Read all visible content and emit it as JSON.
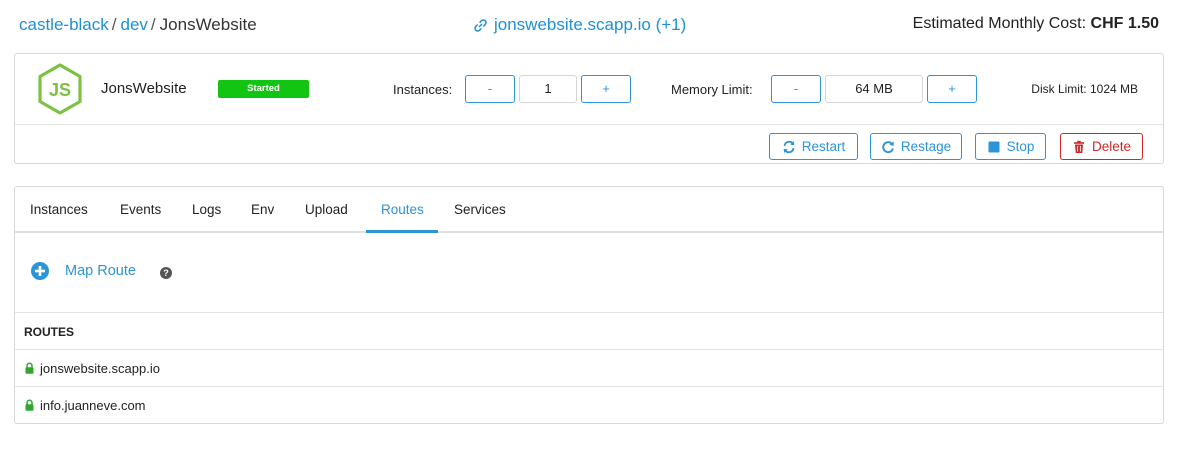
{
  "breadcrumb": {
    "items": [
      "castle-black",
      "dev"
    ],
    "separator": "/",
    "current": "JonsWebsite"
  },
  "app_url": "jonswebsite.scapp.io (+1)",
  "cost": {
    "label": "Estimated Monthly Cost:",
    "value": "CHF 1.50"
  },
  "app": {
    "name": "JonsWebsite",
    "status": "Started",
    "instances_label": "Instances:",
    "instances_value": "1",
    "memory_label": "Memory Limit:",
    "memory_value": "64 MB",
    "disk_limit": "Disk Limit: 1024 MB",
    "decrement": "-",
    "increment": "+"
  },
  "actions": {
    "restart": "Restart",
    "restage": "Restage",
    "stop": "Stop",
    "delete": "Delete"
  },
  "tabs": [
    {
      "label": "Instances"
    },
    {
      "label": "Events"
    },
    {
      "label": "Logs"
    },
    {
      "label": "Env"
    },
    {
      "label": "Upload"
    },
    {
      "label": "Routes"
    },
    {
      "label": "Services"
    }
  ],
  "active_tab": "Routes",
  "map_route": {
    "label": "Map Route",
    "help": "?"
  },
  "routes": {
    "header": "ROUTES",
    "items": [
      "jonswebsite.scapp.io",
      "info.juanneve.com"
    ]
  },
  "colors": {
    "link": "#1e90d6",
    "accent": "#2c94d8",
    "success": "#13c513",
    "danger": "#cc2a2a",
    "lock": "#2ea82e",
    "node_green": "#7cc142"
  }
}
